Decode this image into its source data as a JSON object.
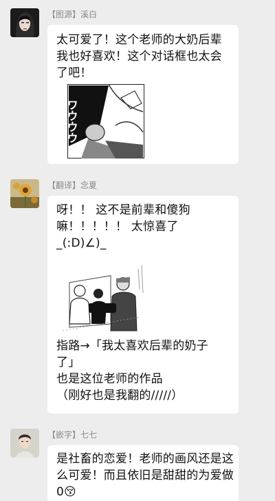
{
  "messages": [
    {
      "tag": "【图源】",
      "name": "溪白",
      "paragraphs": [
        "太可爱了！这个老师的大奶后辈我也好喜欢！这个对话框也太会了吧！"
      ],
      "image_icon": "manga-panel-image",
      "image_text": "ワウウウ"
    },
    {
      "tag": "【翻译】",
      "name": "念夏",
      "paragraphs_top": [
        "呀！！ 这不是前辈和傻狗嘛！！！！！ 太惊喜了_(:D)∠)_"
      ],
      "image_icon": "manga-characters-image",
      "paragraphs_bottom": [
        "指路→「我太喜欢后辈的奶子了」",
        "也是这位老师的作品",
        "（刚好也是我翻的/////）"
      ]
    },
    {
      "tag": "【嵌字】",
      "name": "七七",
      "paragraphs": [
        "是社畜的恋爱！老师的画风还是这么可爱！而且依旧是甜甜的为爱做0😚"
      ]
    }
  ],
  "colors": {
    "background": "#ededed",
    "bubble": "#ffffff",
    "sender": "#8a8a8a",
    "text": "#111111"
  }
}
